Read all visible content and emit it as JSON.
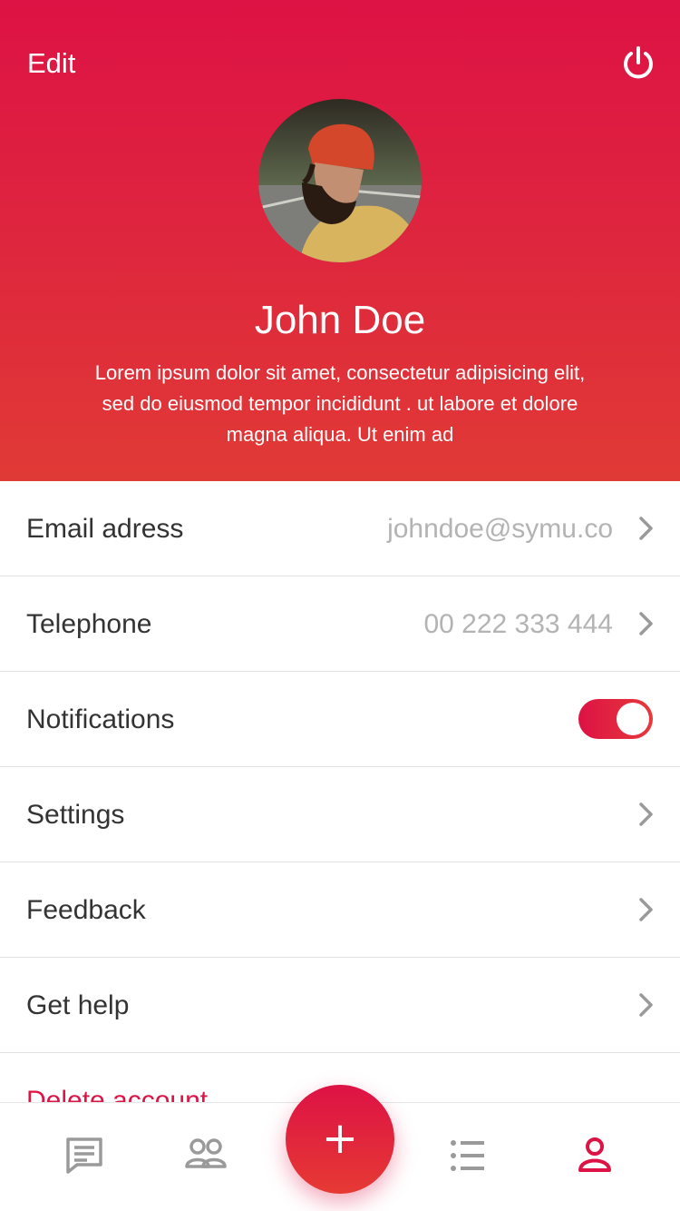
{
  "header": {
    "edit_label": "Edit",
    "name": "John Doe",
    "bio": "Lorem ipsum dolor sit amet, consectetur adipisicing elit, sed do eiusmod tempor incididunt . ut labore et dolore magna aliqua. Ut enim ad"
  },
  "settings": {
    "email": {
      "label": "Email adress",
      "value": "johndoe@symu.co"
    },
    "telephone": {
      "label": "Telephone",
      "value": "00 222 333 444"
    },
    "notifications": {
      "label": "Notifications",
      "enabled": true
    },
    "settings_item": {
      "label": "Settings"
    },
    "feedback": {
      "label": "Feedback"
    },
    "help": {
      "label": "Get help"
    },
    "delete": {
      "label": "Delete account"
    }
  },
  "tabbar": {
    "fab_label": "+",
    "items": [
      "chat-icon",
      "people-icon",
      "list-icon",
      "profile-icon"
    ],
    "active": "profile-icon"
  },
  "colors": {
    "accent": "#dd1245",
    "accent_end": "#e63a34",
    "text": "#333333",
    "muted": "#b3b3b3",
    "icon_inactive": "#9a9a9a"
  }
}
